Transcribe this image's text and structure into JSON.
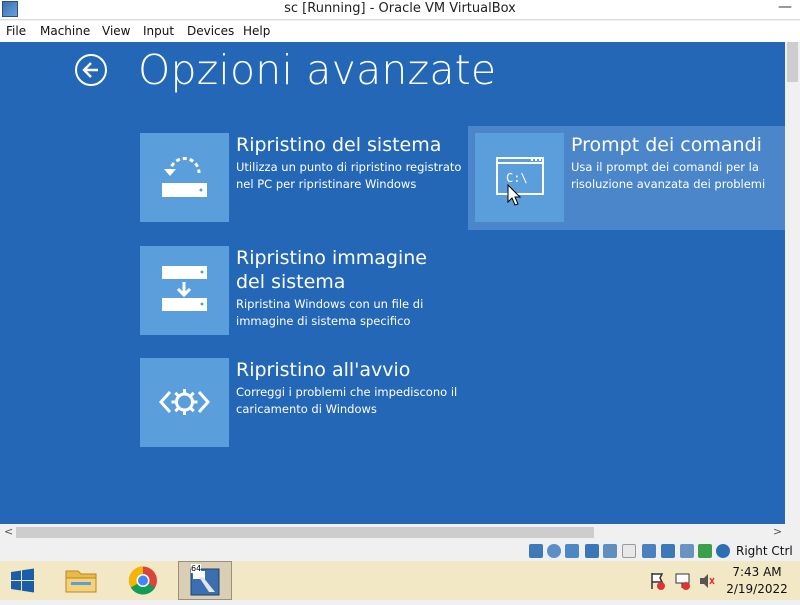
{
  "window": {
    "title": "sc [Running] - Oracle VM VirtualBox",
    "minimize": "—"
  },
  "menu": [
    "File",
    "Machine",
    "View",
    "Input",
    "Devices",
    "Help"
  ],
  "screen": {
    "title": "Opzioni avanzate",
    "tiles": [
      {
        "title": "Ripristino del sistema",
        "desc1": "Utilizza un punto di ripristino registrato",
        "desc2": "nel PC per ripristinare Windows",
        "icon": "system-restore-icon"
      },
      {
        "title1": "Ripristino immagine",
        "title2": "del sistema",
        "desc1": "Ripristina Windows con un file di",
        "desc2": "immagine di sistema specifico",
        "icon": "system-image-icon"
      },
      {
        "title": "Ripristino all'avvio",
        "desc1": "Correggi i problemi che impediscono il",
        "desc2": "caricamento di Windows",
        "icon": "startup-repair-icon"
      },
      {
        "title": "Prompt dei comandi",
        "desc1": "Usa il prompt dei comandi per la",
        "desc2": "risoluzione avanzata dei problemi",
        "icon": "command-prompt-icon",
        "cmd_text": "C:\\",
        "highlighted": true
      }
    ]
  },
  "statusbar": {
    "host_key": "Right Ctrl"
  },
  "taskbar": {
    "time": "7:43 AM",
    "date": "2/19/2022",
    "vbox_badge": "64"
  },
  "colors": {
    "screen_bg": "#2367b6",
    "tile_bg": "#5a9fdb",
    "highlight": "#4a86c9",
    "taskbar": "#f3e8c6"
  }
}
